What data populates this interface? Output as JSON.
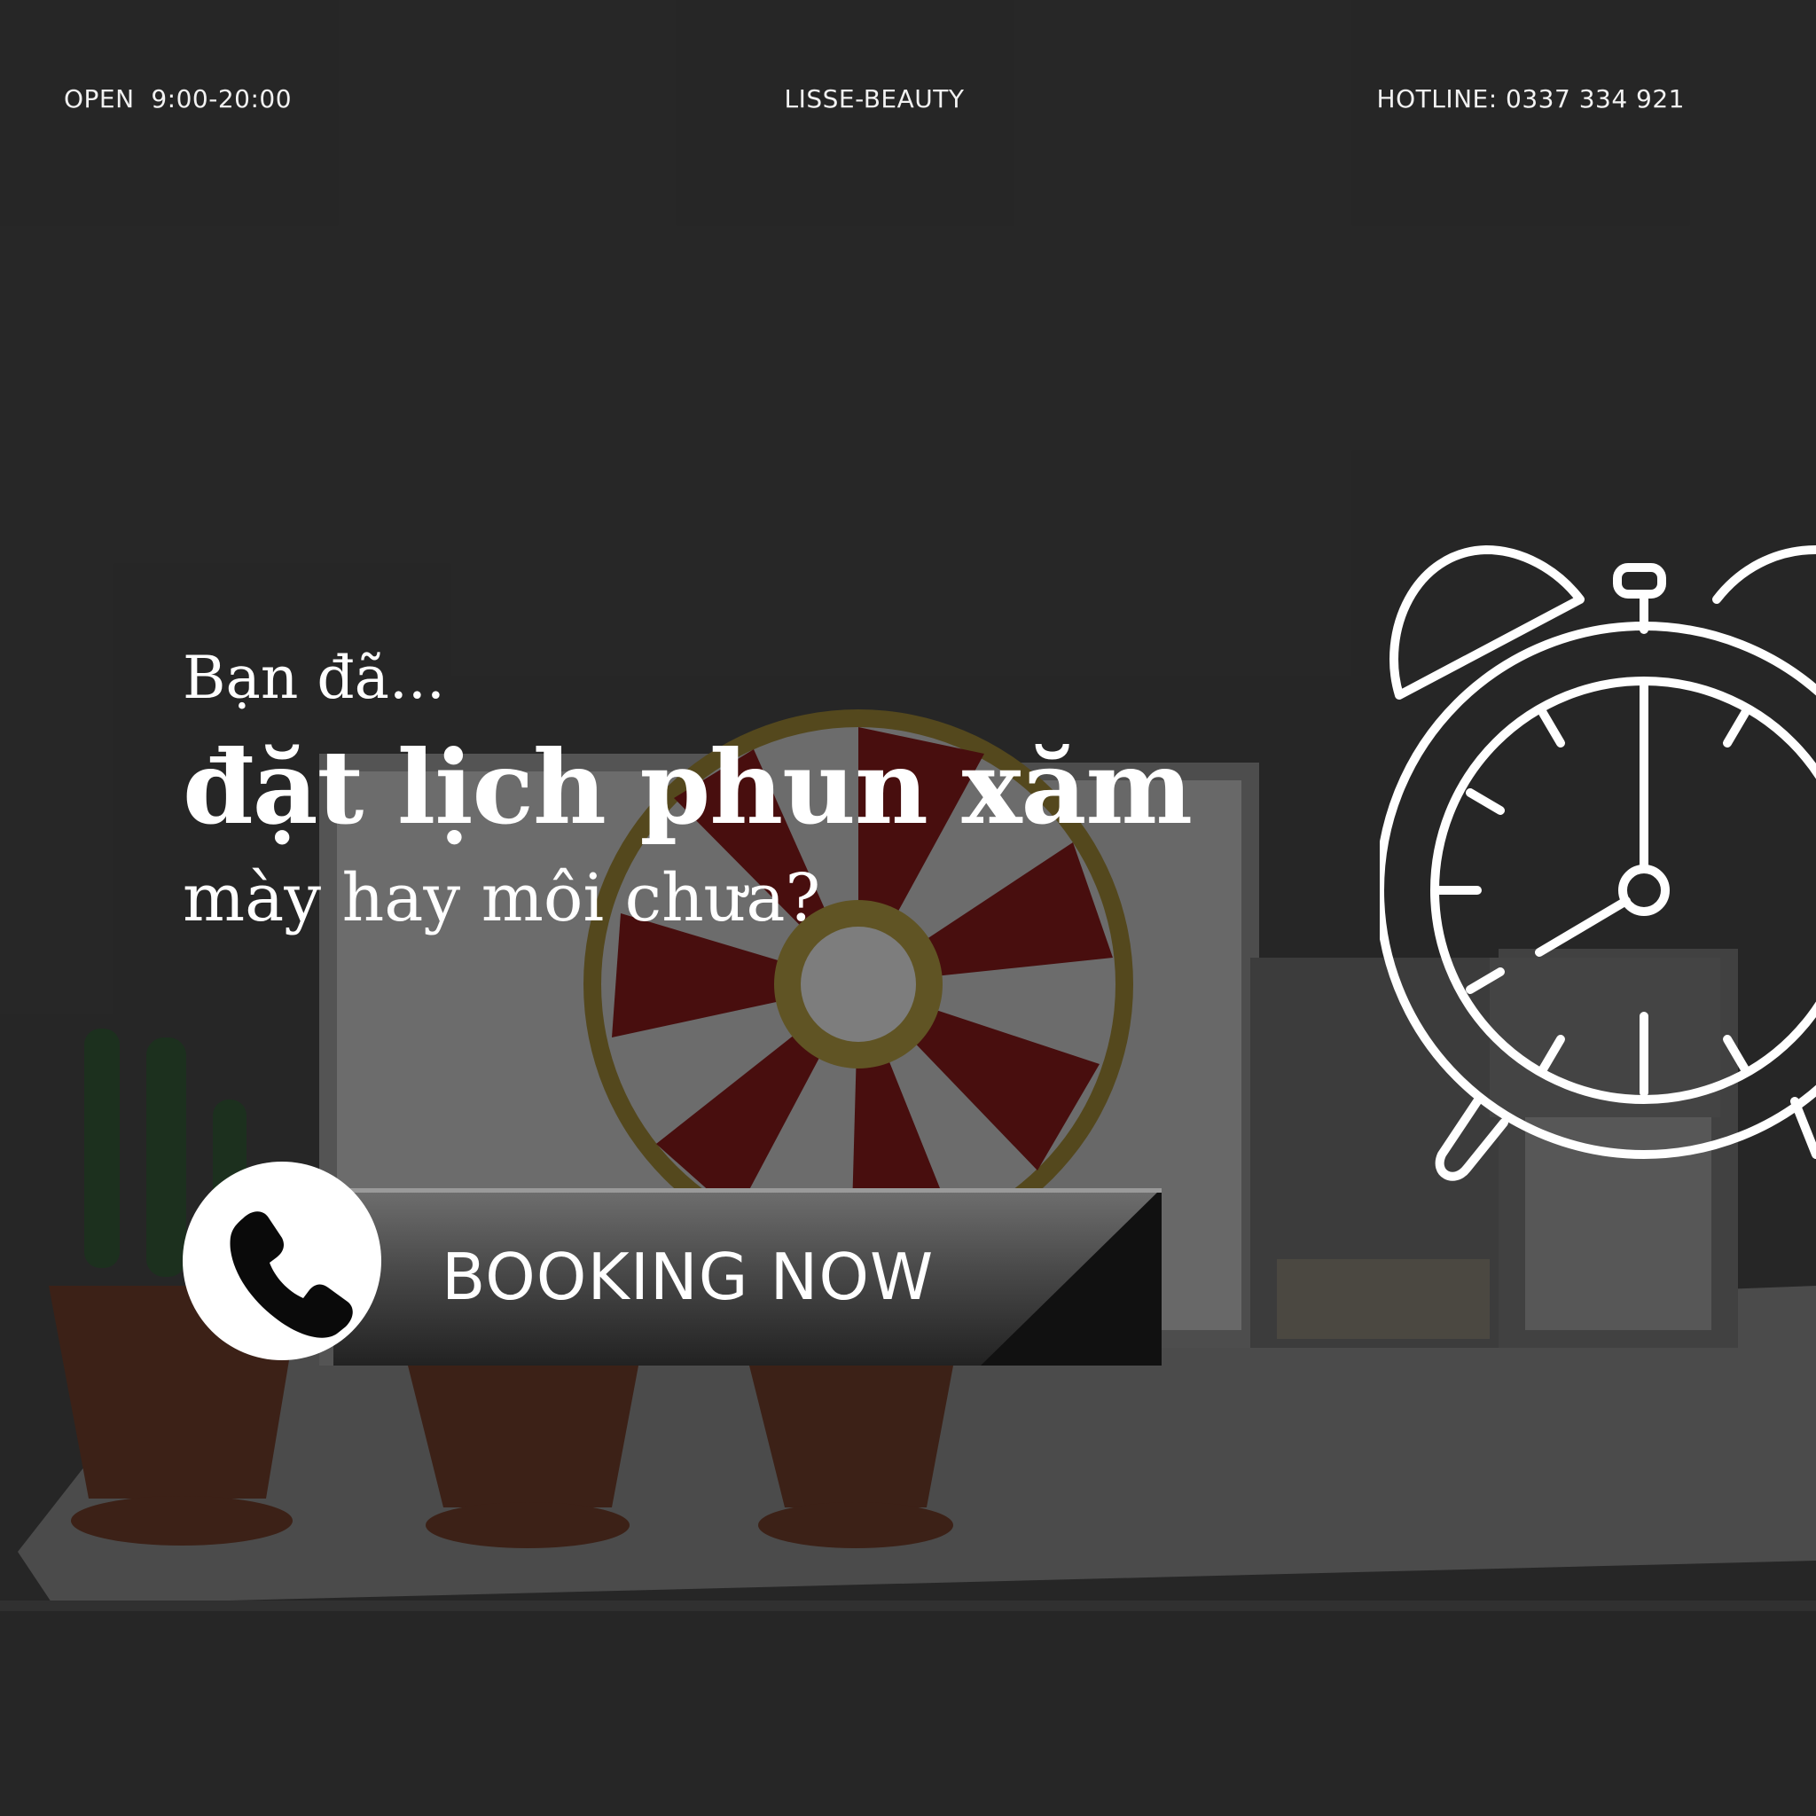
{
  "header": {
    "hours": "OPEN  9:00-20:00",
    "brand": "LISSE-BEAUTY",
    "hotline": "HOTLINE: 0337 334 921"
  },
  "headline": {
    "pre": "Bạn đã...",
    "main": "đặt lịch phun xăm",
    "sub": "mày hay môi chưa?"
  },
  "cta": {
    "label": "BOOKING NOW",
    "icon": "phone-icon"
  },
  "decor": {
    "clock_icon": "alarm-clock-icon",
    "background_icon": "photo-background",
    "accent": "#ffffff",
    "wheel_red": "#8e1212",
    "pot": "#6b3a22"
  }
}
